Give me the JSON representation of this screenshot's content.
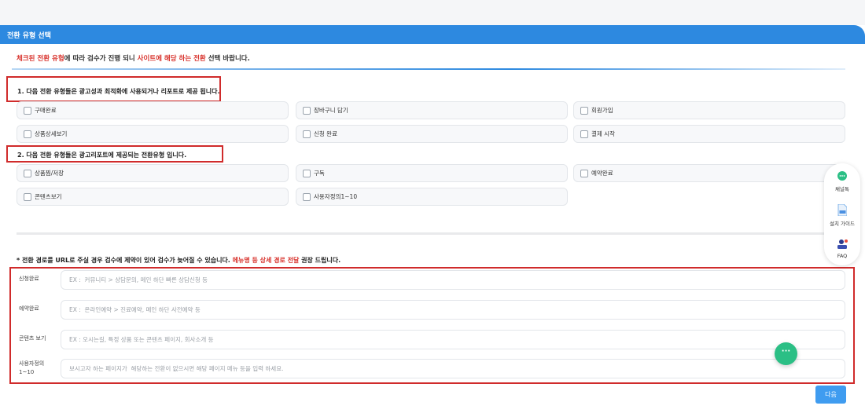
{
  "header": {
    "title": "전환 유형 선택"
  },
  "notice": {
    "part1": "체크된 전환 유형",
    "part2": "에 따라 검수가 진행 되니 ",
    "part3": "사이트에 해당 하는 전환",
    "part4": " 선택 바랍니다."
  },
  "section1": {
    "title": "1. 다음 전환 유형들은 광고성과 최적화에 사용되거나 리포트로 제공 됩니다.",
    "items": [
      "구매완료",
      "장바구니 담기",
      "회원가입",
      "상품상세보기",
      "신청 완료",
      "결제 시작"
    ]
  },
  "section2": {
    "title": "2. 다음 전환 유형들은 광고리포트에 제공되는 전환유형 입니다.",
    "items": [
      "상품찜/저장",
      "구독",
      "예약완료",
      "콘텐츠보기",
      "사용자정의1~10"
    ]
  },
  "route": {
    "notice_part1": "* 전환 경로를 URL로 주실 경우 검수에 제약이 있어 검수가 늦어질 수 있습니다. ",
    "notice_part2": "메뉴명 등 상세 경로 전달",
    "notice_part3": " 권장 드립니다.",
    "rows": [
      {
        "label": "신청완료",
        "placeholder": "EX :  커뮤니티 > 상담문의, 메인 하단 빠른 상담신청 등"
      },
      {
        "label": "예약완료",
        "placeholder": "EX :  온라인예약 > 진료예약, 메인 하단 사전예약 등"
      },
      {
        "label": "콘텐츠 보기",
        "placeholder": "EX : 오시는길, 특정 상품 또는 콘텐츠 페이지, 회사소개 등"
      },
      {
        "label": "사용자정의 1~10",
        "placeholder": "보시고자 하는 페이지가  해당하는 전환이 없으시면 해당 페이지 메뉴 등을 입력 하세요."
      }
    ]
  },
  "buttons": {
    "next": "다음"
  },
  "side_panel": {
    "items": [
      {
        "label": "채널톡",
        "icon": "chat-bubble-icon"
      },
      {
        "label": "설치 가이드",
        "icon": "document-icon"
      },
      {
        "label": "FAQ",
        "icon": "faq-icon"
      }
    ]
  },
  "colors": {
    "accent": "#2d89e0",
    "highlight_red": "#d8322c",
    "annotation_red": "#d02b2b",
    "chat_green": "#2bbf85"
  }
}
